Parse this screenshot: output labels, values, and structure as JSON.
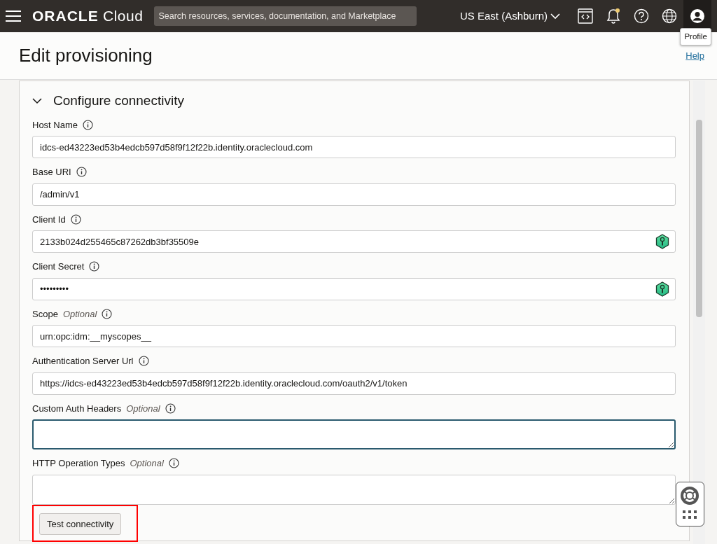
{
  "header": {
    "logo_brand": "ORACLE",
    "logo_product": "Cloud",
    "search": {
      "placeholder": "Search resources, services, documentation, and Marketplace"
    },
    "region": "US East (Ashburn)",
    "notification_dot": true,
    "tooltip": "Profile"
  },
  "page": {
    "title": "Edit provisioning",
    "help_link": "Help"
  },
  "section": {
    "title": "Configure connectivity",
    "expanded": true,
    "fields": [
      {
        "label": "Host Name",
        "kind": "input",
        "value": "idcs-ed43223ed53b4edcb597d58f9f12f22b.identity.oraclecloud.com",
        "focused": false
      },
      {
        "label": "Base URI",
        "kind": "input",
        "value": "/admin/v1",
        "focused": false
      },
      {
        "label": "Client Id",
        "kind": "input",
        "value": "2133b024d255465c87262db3bf35509e",
        "key_icon": true,
        "focused": false
      },
      {
        "label": "Client Secret",
        "kind": "input",
        "value": "•••••••••",
        "key_icon": true,
        "focused": false
      },
      {
        "label": "Scope",
        "optional_tag": "Optional",
        "kind": "input",
        "value": "urn:opc:idm:__myscopes__",
        "focused": false
      },
      {
        "label": "Authentication Server Url",
        "kind": "input",
        "value": "https://idcs-ed43223ed53b4edcb597d58f9f12f22b.identity.oraclecloud.com/oauth2/v1/token",
        "focused": false
      },
      {
        "label": "Custom Auth Headers",
        "optional_tag": "Optional",
        "kind": "textarea",
        "focused": true
      },
      {
        "label": "HTTP Operation Types",
        "optional_tag": "Optional",
        "kind": "textarea",
        "focused": false
      }
    ],
    "test_button": "Test connectivity",
    "button_highlighted": true
  }
}
